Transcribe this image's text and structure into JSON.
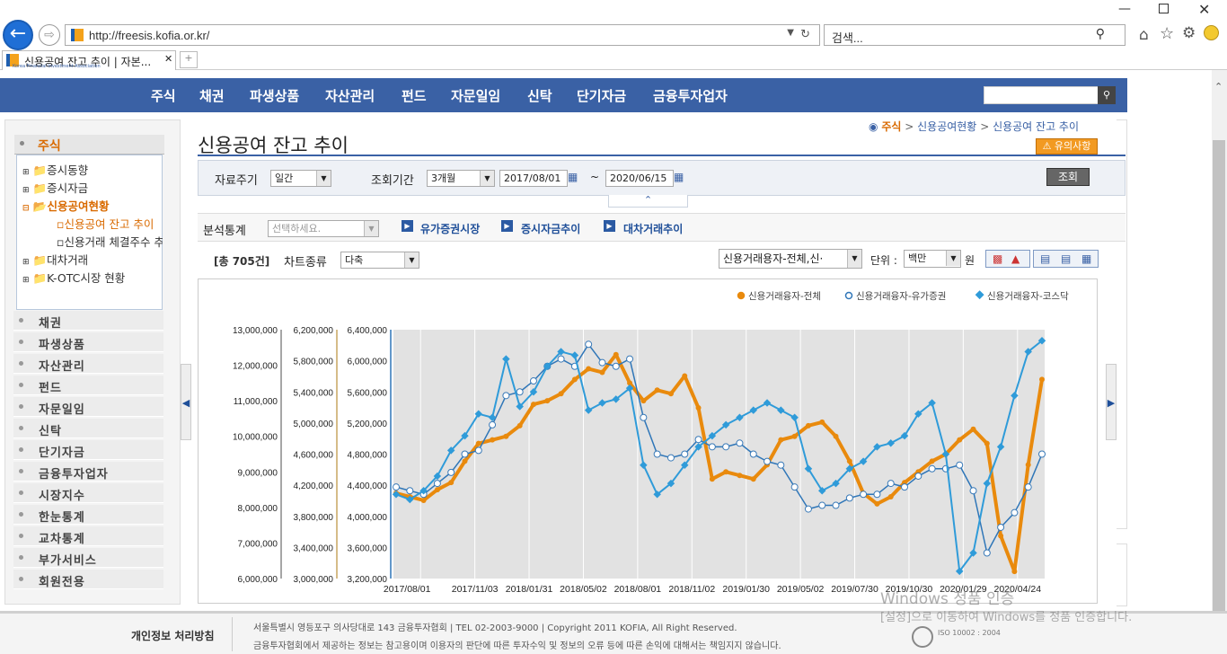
{
  "browser": {
    "url": "http://freesis.kofia.or.kr/",
    "search_placeholder": "검색...",
    "tab_title": "신용공여 잔고 추이 | 자본...",
    "logo_caption": "Korea Financial Investment Association"
  },
  "gnb": {
    "items": [
      "주식",
      "채권",
      "파생상품",
      "자산관리",
      "펀드",
      "자문일임",
      "신탁",
      "단기자금",
      "금융투자업자"
    ]
  },
  "sidebar": {
    "top": "주식",
    "tree": [
      "증시동향",
      "증시자금",
      "신용공여현황",
      "신용공여 잔고 추이",
      "신용거래 체결주수 추",
      "대차거래",
      "K-OTC시장 현황"
    ],
    "menus": [
      "채권",
      "파생상품",
      "자산관리",
      "펀드",
      "자문일임",
      "신탁",
      "단기자금",
      "금융투자업자",
      "시장지수",
      "한눈통계",
      "교차통계",
      "부가서비스",
      "회원전용"
    ]
  },
  "page": {
    "title": "신용공여 잔고 추이",
    "breadcrumb": [
      "주식",
      "신용공여현황",
      "신용공여 잔고 추이"
    ],
    "notice_button": "⚠ 유의사항"
  },
  "filters": {
    "period_label": "자료주기",
    "period_value": "일간",
    "range_label": "조회기간",
    "range_value": "3개월",
    "date_from": "2017/08/01",
    "date_tilde": "~",
    "date_to": "2020/06/15",
    "search_button": "조회",
    "analysis_label": "분석통계",
    "analysis_placeholder": "선택하세요.",
    "links": [
      "유가증권시장",
      "증시자금추이",
      "대차거래추이"
    ],
    "total_count": "[총 705건]",
    "chart_type_label": "차트종류",
    "chart_type_value": "다축",
    "series_select": "신용거래용자-전체,신·",
    "unit_label": "단위 :",
    "unit_value": "백만",
    "unit_suffix": "원"
  },
  "footer": {
    "privacy": "개인정보 처리방침",
    "address": "서울특별시 영등포구 의사당대로 143 금융투자협회   |  TEL 02-2003-9000  |  Copyright 2011 KOFIA, All Right Reserved.",
    "disclaimer": "금융투자협회에서 제공하는 정보는 참고용이며 이용자의 판단에 따른 투자수익 및 정보의 오류 등에 따른 손익에 대해서는 책임지지 않습니다.",
    "iso": "ISO 10002 : 2004",
    "watermark1": "Windows 정품 인증",
    "watermark2": "[설정]으로 이동하여 Windows를 정품 인증합니다."
  },
  "colors": {
    "accent": "#3a61a5",
    "series_total": "#e98a0d",
    "series_kospi": "#2f9bd9",
    "series_kosdaq": "#2f9bd9"
  },
  "chart_data": {
    "type": "line",
    "legend": [
      "신용거래융자-전체",
      "신용거래융자-유가증권",
      "신용거래융자-코스닥"
    ],
    "x_labels": [
      "2017/08/01",
      "2017/11/03",
      "2018/01/31",
      "2018/05/02",
      "2018/08/01",
      "2018/11/02",
      "2019/01/30",
      "2019/05/02",
      "2019/07/30",
      "2019/10/30",
      "2020/01/29",
      "2020/04/24"
    ],
    "axis1": {
      "ticks": [
        "13,000,000",
        "12,000,000",
        "11,000,000",
        "10,000,000",
        "9,000,000",
        "8,000,000",
        "7,000,000",
        "6,000,000"
      ],
      "min": 6000000,
      "max": 13000000
    },
    "axis2": {
      "ticks": [
        "6,200,000",
        "5,800,000",
        "5,400,000",
        "5,000,000",
        "4,600,000",
        "4,200,000",
        "3,800,000",
        "3,400,000",
        "3,000,000"
      ],
      "min": 3000000,
      "max": 6400000
    },
    "axis3": {
      "ticks": [
        "6,400,000",
        "6,000,000",
        "5,600,000",
        "5,200,000",
        "4,800,000",
        "4,400,000",
        "4,000,000",
        "3,600,000",
        "3,200,000"
      ],
      "min": 3200000,
      "max": 6600000
    },
    "series": [
      {
        "name": "신용거래융자-전체",
        "color": "#e98a0d",
        "values": [
          8400000,
          8300000,
          8200000,
          8500000,
          8700000,
          9300000,
          9800000,
          9900000,
          10000000,
          10300000,
          10900000,
          11000000,
          11200000,
          11600000,
          11900000,
          11800000,
          12300000,
          11500000,
          11000000,
          11300000,
          11200000,
          11700000,
          10800000,
          8800000,
          9000000,
          8900000,
          8800000,
          9200000,
          9900000,
          10000000,
          10300000,
          10400000,
          10000000,
          9300000,
          8400000,
          8100000,
          8300000,
          8700000,
          9000000,
          9300000,
          9500000,
          9900000,
          10200000,
          9800000,
          7200000,
          6200000,
          9200000,
          11600000
        ]
      },
      {
        "name": "신용거래융자-유가증권",
        "color": "#2f9bd9",
        "values": [
          4250000,
          4200000,
          4150000,
          4300000,
          4450000,
          4700000,
          4750000,
          5100000,
          5500000,
          5550000,
          5700000,
          5900000,
          6000000,
          5900000,
          6200000,
          5950000,
          5900000,
          6000000,
          5200000,
          4700000,
          4650000,
          4700000,
          4900000,
          4800000,
          4800000,
          4850000,
          4700000,
          4600000,
          4550000,
          4250000,
          3950000,
          4000000,
          4000000,
          4100000,
          4150000,
          4150000,
          4300000,
          4250000,
          4400000,
          4500000,
          4500000,
          4550000,
          4200000,
          3350000,
          3700000,
          3900000,
          4250000,
          4700000
        ]
      },
      {
        "name": "신용거래융자-코스닥",
        "color": "#2f9bd9",
        "values": [
          4350000,
          4280000,
          4400000,
          4600000,
          4950000,
          5150000,
          5450000,
          5400000,
          6200000,
          5550000,
          5750000,
          6100000,
          6300000,
          6250000,
          5500000,
          5600000,
          5650000,
          5800000,
          4750000,
          4350000,
          4500000,
          4750000,
          5000000,
          5150000,
          5300000,
          5400000,
          5500000,
          5600000,
          5500000,
          5400000,
          4700000,
          4400000,
          4500000,
          4700000,
          4800000,
          5000000,
          5050000,
          5150000,
          5450000,
          5600000,
          4900000,
          3300000,
          3550000,
          4500000,
          5000000,
          5700000,
          6300000,
          6450000
        ]
      }
    ]
  }
}
